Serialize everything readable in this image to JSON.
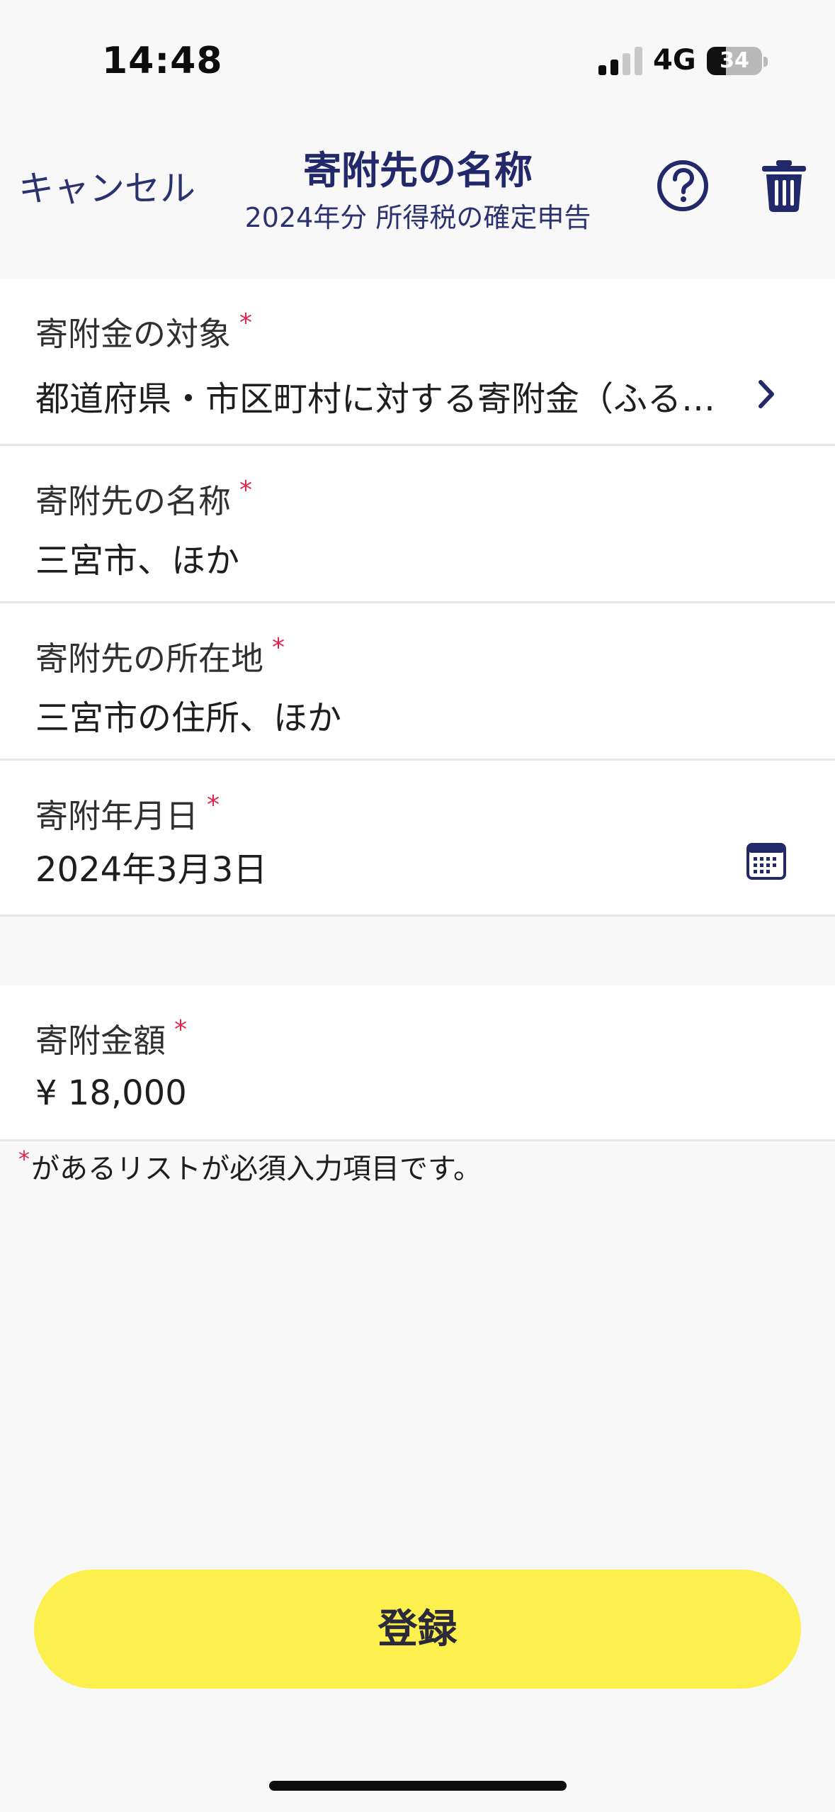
{
  "status_bar": {
    "time": "14:48",
    "network": "4G",
    "battery_percent": 34,
    "battery_label": "34"
  },
  "nav": {
    "cancel_label": "キャンセル",
    "title": "寄附先の名称",
    "subtitle": "2024年分 所得税の確定申告",
    "help_icon": "question-circle-icon",
    "delete_icon": "trash-icon"
  },
  "form": {
    "required_mark": "*",
    "donation_target": {
      "label": "寄附金の対象",
      "value": "都道府県・市区町村に対する寄附金（ふるさと納税など）"
    },
    "donee_name": {
      "label": "寄附先の名称",
      "value": "三宮市、ほか"
    },
    "donee_address": {
      "label": "寄附先の所在地",
      "value": "三宮市の住所、ほか"
    },
    "donation_date": {
      "label": "寄附年月日",
      "value": "2024年3月3日"
    },
    "donation_amount": {
      "label": "寄附金額",
      "value": "¥ 18,000"
    }
  },
  "note": {
    "mark": "*",
    "text": "があるリストが必須入力項目です。"
  },
  "submit_label": "登録",
  "colors": {
    "accent_navy": "#22296a",
    "required_red": "#e0264d",
    "button_yellow": "#fdf04e",
    "background": "#f8f8f8"
  }
}
